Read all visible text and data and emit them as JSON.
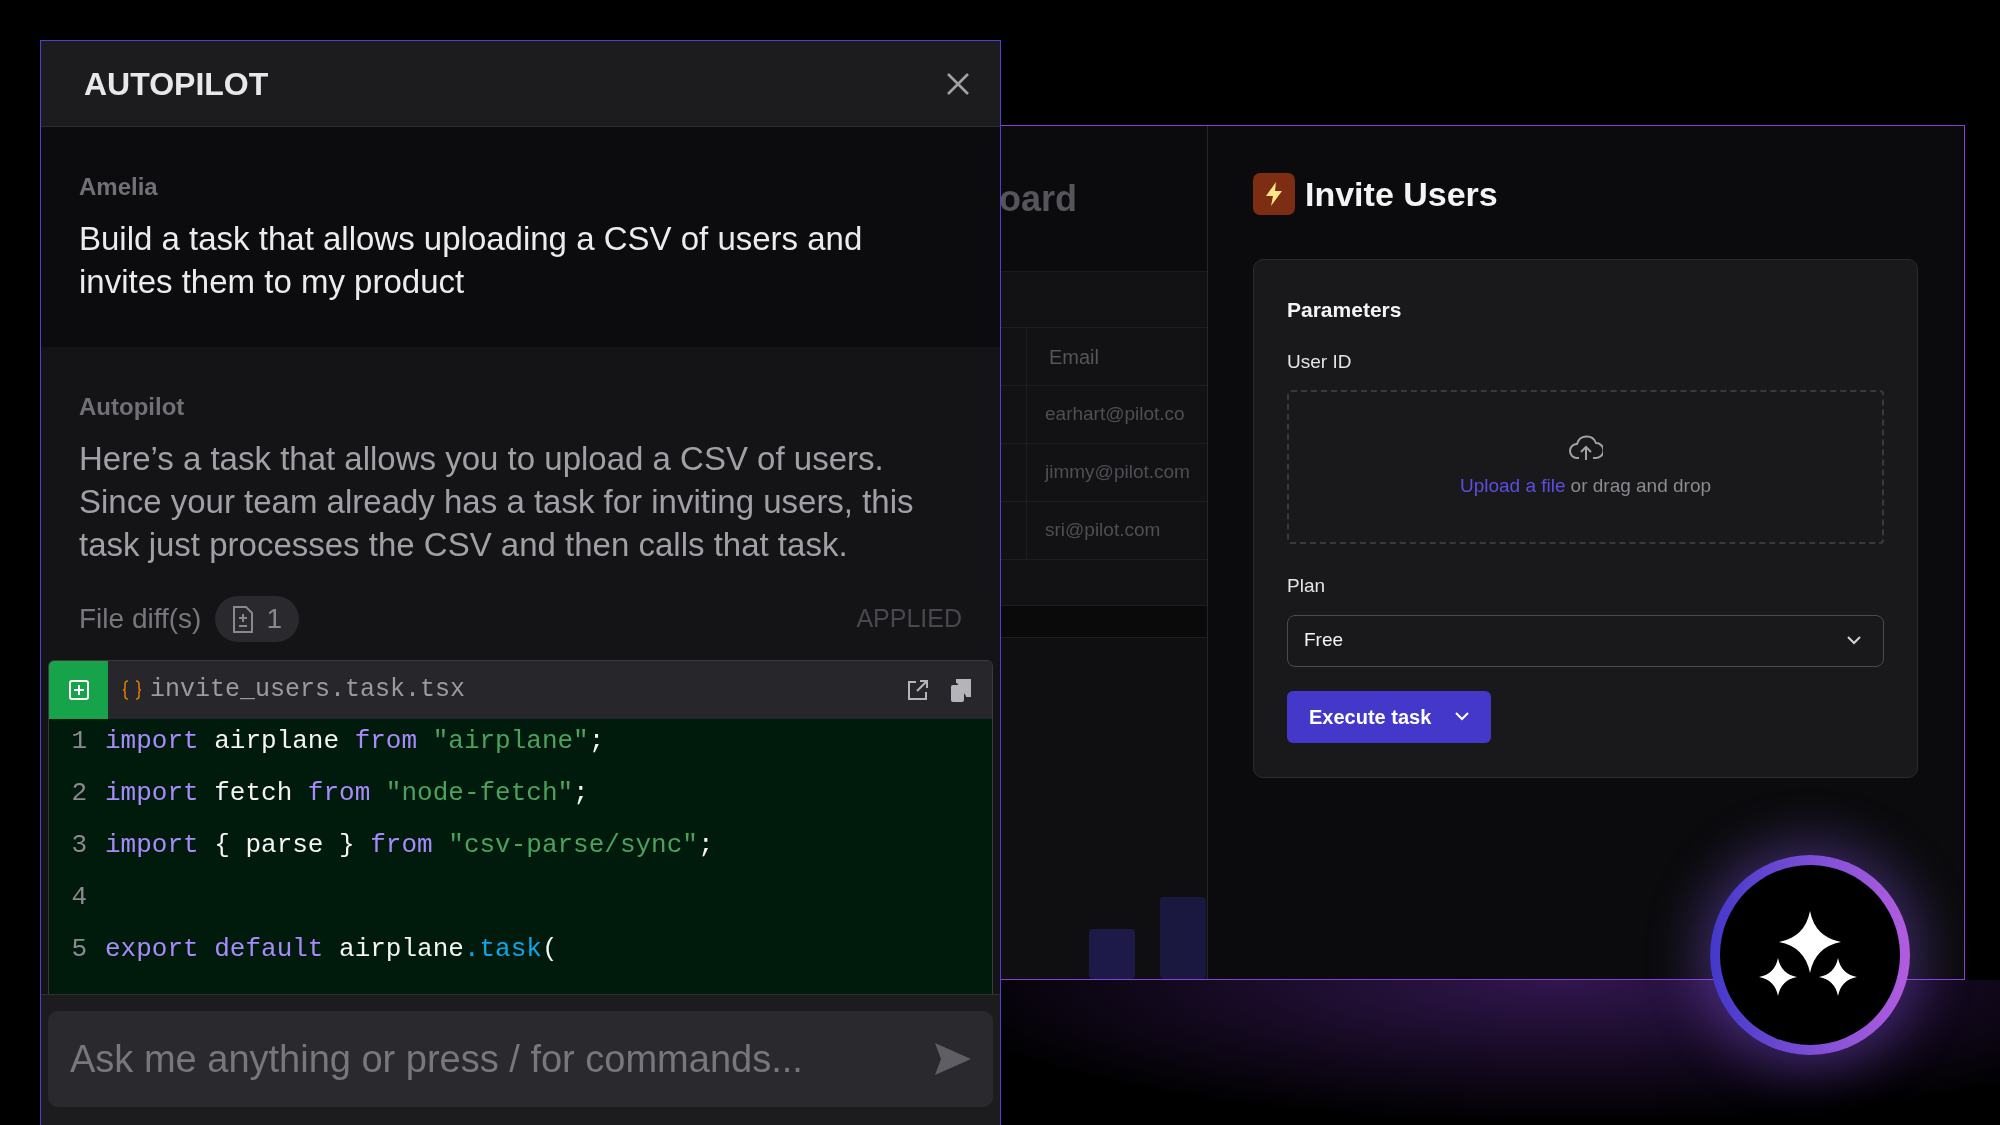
{
  "autopilot": {
    "title": "AUTOPILOT",
    "messages": [
      {
        "kind": "user",
        "author": "Amelia",
        "text": "Build a task that allows uploading a CSV of users and invites them to my product"
      },
      {
        "kind": "assistant",
        "author": "Autopilot",
        "text": "Here’s a task that allows you to upload a CSV of users. Since your team already has a task for inviting users, this task just processes the CSV and then calls that task."
      }
    ],
    "file_diffs": {
      "label": "File diff(s)",
      "count": "1",
      "status": "APPLIED"
    },
    "code_file": {
      "name": "invite_users.task.tsx",
      "lines": [
        {
          "number": "1",
          "tokens": [
            {
              "kind": "keyword",
              "text": "import"
            },
            {
              "kind": "plain",
              "text": " airplane "
            },
            {
              "kind": "keyword",
              "text": "from"
            },
            {
              "kind": "string",
              "text": " \"airplane\""
            },
            {
              "kind": "plain",
              "text": ";"
            }
          ]
        },
        {
          "number": "2",
          "tokens": [
            {
              "kind": "keyword",
              "text": "import"
            },
            {
              "kind": "plain",
              "text": " fetch "
            },
            {
              "kind": "keyword",
              "text": "from"
            },
            {
              "kind": "string",
              "text": " \"node-fetch\""
            },
            {
              "kind": "plain",
              "text": ";"
            }
          ]
        },
        {
          "number": "3",
          "tokens": [
            {
              "kind": "keyword",
              "text": "import"
            },
            {
              "kind": "plain",
              "text": " { parse } "
            },
            {
              "kind": "keyword",
              "text": "from"
            },
            {
              "kind": "string",
              "text": " \"csv-parse/sync\""
            },
            {
              "kind": "plain",
              "text": ";"
            }
          ]
        },
        {
          "number": "4"
        },
        {
          "number": "5",
          "tokens": [
            {
              "kind": "keyword",
              "text": "export default"
            },
            {
              "kind": "plain",
              "text": " airplane"
            },
            {
              "kind": "method",
              "text": ".task"
            },
            {
              "kind": "plain",
              "text": "("
            }
          ]
        }
      ]
    },
    "input": {
      "placeholder": "Ask me anything or press / for commands..."
    }
  },
  "dashboard": {
    "title": "oard",
    "column": "Email",
    "rows": [
      "earhart@pilot.co",
      "jimmy@pilot.com",
      "sri@pilot.com"
    ]
  },
  "task": {
    "title": "Invite Users",
    "section": "Parameters",
    "fields": [
      {
        "kind": "upload",
        "label": "User ID",
        "link": "Upload a file",
        "hint": "or drag and drop"
      },
      {
        "kind": "select",
        "label": "Plan",
        "value": "Free"
      }
    ],
    "button": "Execute task"
  }
}
